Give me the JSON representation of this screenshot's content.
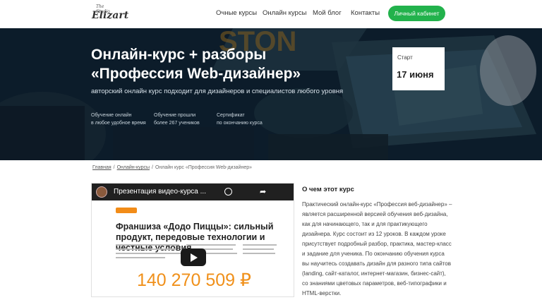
{
  "header": {
    "logo_top": "The Studio",
    "logo_main": "Elizart",
    "nav": [
      "Очные курсы",
      "Онлайн курсы",
      "Мой блог",
      "Контакты"
    ],
    "cabinet_button": "Личный кабинет",
    "accent_color": "#22b24c"
  },
  "hero": {
    "title_line1": "Онлайн-курс + разборы",
    "title_line2": "«Профессия Web-дизайнер»",
    "subtitle": "авторский онлайн курс подходит для дизайнеров и специалистов любого уровня",
    "features": [
      {
        "line1": "Обучение онлайн",
        "line2": "в любое удобное время"
      },
      {
        "line1": "Обучение прошли",
        "line2": "более 267 учеников"
      },
      {
        "line1": "Сертификат",
        "line2": "по окончанию курса"
      }
    ],
    "start_label": "Старт",
    "start_date": "17 июня"
  },
  "breadcrumb": {
    "items": [
      "Главная",
      "Онлайн-курсы",
      "Онлайн курс «Профессия Web-дизайнер»"
    ],
    "separator": "/"
  },
  "video": {
    "title": "Презентация видео-курса ...",
    "heading": "Франшиза «Додо Пиццы»: сильный продукт, передовые технологии и честные условия",
    "price": "140 270 509 ₽",
    "icons": [
      "clock-icon",
      "share-icon",
      "play-icon"
    ]
  },
  "about": {
    "title": "О чем этот курс",
    "text": "Практический онлайн-курс «Профессия веб-дизайнер» – является расширенной версией обучения веб-дизайна, как для начинающего, так и для практикующего дизайнера. Курс состоит из 12 уроков. В каждом уроке присутствует подробный разбор, практика, мастер-класс и задание для ученика. По окончанию обучения курса вы научитесь создавать дизайн для разного типа сайтов (landing, сайт-каталог, интернет-магазин, бизнес-сайт), со знаниями цветовых параметров, веб-типографики и HTML-верстки."
  }
}
